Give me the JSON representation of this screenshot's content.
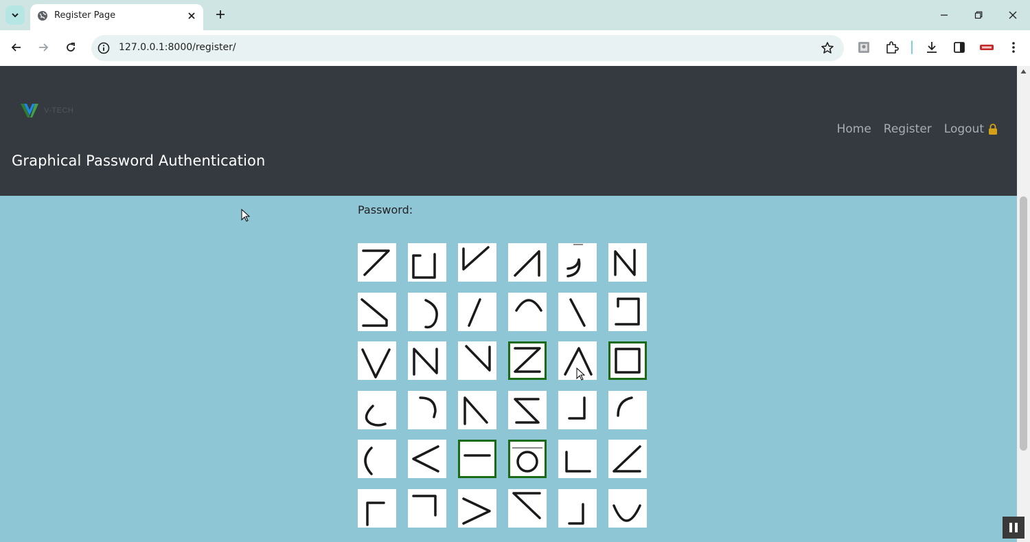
{
  "browser": {
    "tab_title": "Register Page",
    "url": "127.0.0.1:8000/register/"
  },
  "header": {
    "logo_text": "V-TECH",
    "title": "Graphical Password Authentication",
    "nav": {
      "home": "Home",
      "register": "Register",
      "logout": "Logout"
    }
  },
  "form": {
    "password_label": "Password:"
  },
  "grid": {
    "rows": 6,
    "cols": 6,
    "cells": [
      {
        "shape": "seven-stroke",
        "selected": false
      },
      {
        "shape": "square-open-top",
        "selected": false
      },
      {
        "shape": "check-v",
        "selected": false
      },
      {
        "shape": "slash-hook",
        "selected": false
      },
      {
        "shape": "hook-right",
        "selected": false
      },
      {
        "shape": "letter-n",
        "selected": false
      },
      {
        "shape": "triangle-bottom",
        "selected": false
      },
      {
        "shape": "arc-right",
        "selected": false
      },
      {
        "shape": "slash",
        "selected": false
      },
      {
        "shape": "arc-top",
        "selected": false
      },
      {
        "shape": "backslash",
        "selected": false
      },
      {
        "shape": "bracket-right",
        "selected": false
      },
      {
        "shape": "letter-v",
        "selected": false
      },
      {
        "shape": "letter-n-upper",
        "selected": false
      },
      {
        "shape": "backslash-hook",
        "selected": false
      },
      {
        "shape": "letter-z",
        "selected": true
      },
      {
        "shape": "caret-up",
        "selected": false
      },
      {
        "shape": "square",
        "selected": true
      },
      {
        "shape": "arc-bottom-left",
        "selected": false
      },
      {
        "shape": "arc-top-right",
        "selected": false
      },
      {
        "shape": "caret-diagonal",
        "selected": false
      },
      {
        "shape": "sigma",
        "selected": false
      },
      {
        "shape": "corner-bottom-right",
        "selected": false
      },
      {
        "shape": "arc-top-left",
        "selected": false
      },
      {
        "shape": "arc-left",
        "selected": false
      },
      {
        "shape": "less-than",
        "selected": false
      },
      {
        "shape": "horizontal-line",
        "selected": true
      },
      {
        "shape": "circle",
        "selected": true
      },
      {
        "shape": "corner-bottom-left",
        "selected": false
      },
      {
        "shape": "angle-bottom",
        "selected": false
      },
      {
        "shape": "corner-top-left",
        "selected": false
      },
      {
        "shape": "corner-top-right",
        "selected": false
      },
      {
        "shape": "greater-than",
        "selected": false
      },
      {
        "shape": "angle-top",
        "selected": false
      },
      {
        "shape": "corner-right-bottom",
        "selected": false
      },
      {
        "shape": "arc-bottom",
        "selected": false
      }
    ]
  },
  "colors": {
    "header_bg": "#343a40",
    "page_bg": "#8ec6d6",
    "selected_border": "#1b6b16",
    "nav_text": "#a9adb1",
    "lock_icon": "#d4a017"
  }
}
